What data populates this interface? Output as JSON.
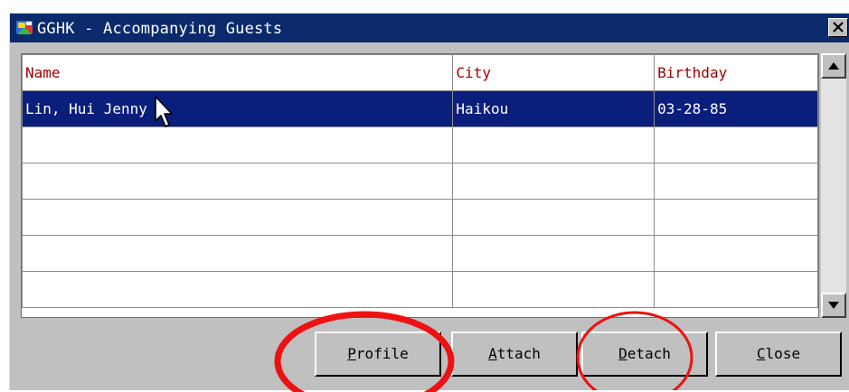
{
  "window": {
    "title": "GGHK - Accompanying Guests"
  },
  "grid": {
    "columns": [
      "Name",
      "City",
      "Birthday"
    ],
    "rows": [
      [
        "Lin, Hui Jenny",
        "Haikou",
        "03-28-85"
      ],
      [
        "",
        "",
        ""
      ],
      [
        "",
        "",
        ""
      ],
      [
        "",
        "",
        ""
      ],
      [
        "",
        "",
        ""
      ],
      [
        "",
        "",
        ""
      ]
    ],
    "selected_row": 0
  },
  "buttons": {
    "profile": {
      "mnemonic": "P",
      "rest": "rofile"
    },
    "attach": {
      "mnemonic": "A",
      "rest": "ttach"
    },
    "detach": {
      "mnemonic": "D",
      "rest": "etach"
    },
    "close": {
      "mnemonic": "C",
      "rest": "lose"
    }
  },
  "annotations": {
    "color": "#ee1111",
    "circled_buttons": [
      "Profile",
      "Detach"
    ]
  },
  "colors": {
    "titlebar": "#0a2a6c",
    "selection": "#0a1e7c",
    "header_text": "#a00000"
  },
  "icons": [
    "app-icon",
    "close-icon",
    "scroll-up-arrow-icon",
    "scroll-down-arrow-icon",
    "mouse-cursor-icon"
  ]
}
